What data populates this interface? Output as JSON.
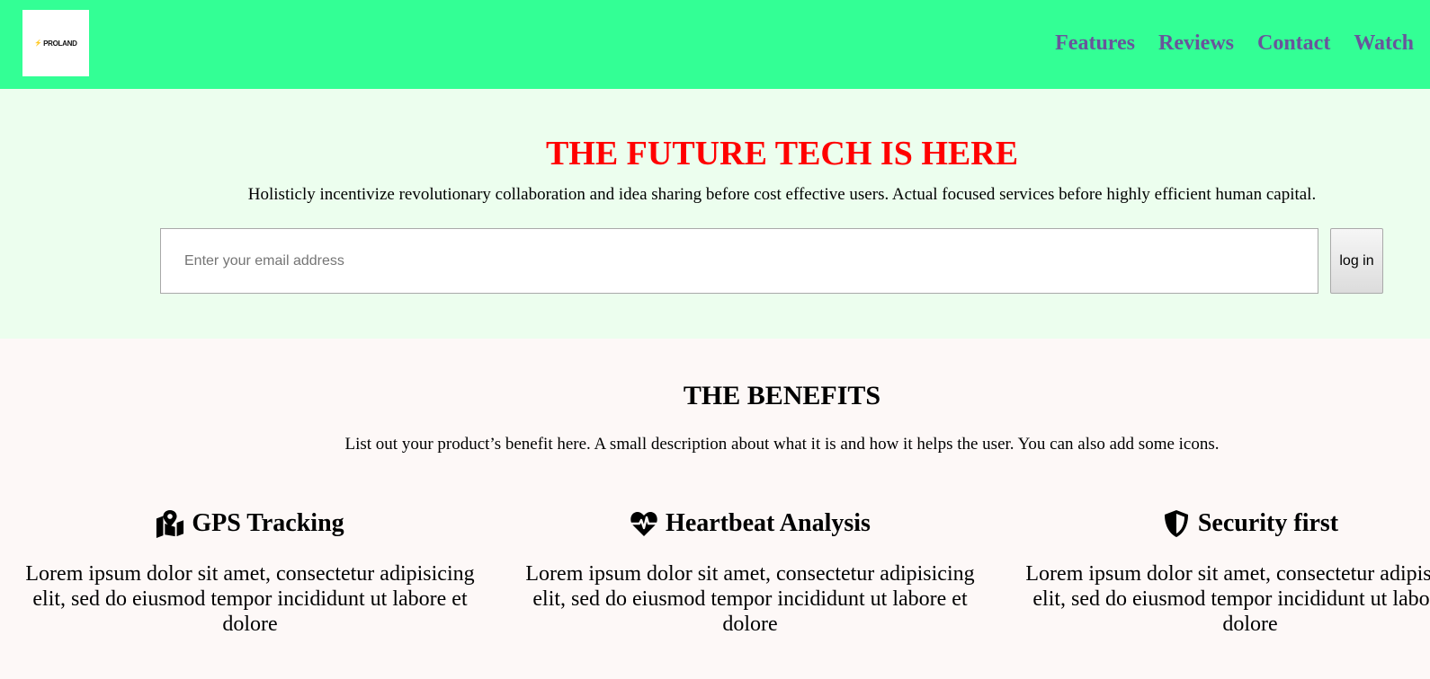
{
  "header": {
    "logo_text": "PROLAND",
    "nav": [
      "Features",
      "Reviews",
      "Contact",
      "Watch"
    ]
  },
  "hero": {
    "title": "THE FUTURE TECH IS HERE",
    "subtitle": "Holisticly incentivize revolutionary collaboration and idea sharing before cost effective users. Actual focused services before highly efficient human capital.",
    "email_placeholder": "Enter your email address",
    "login_label": "log in"
  },
  "benefits": {
    "title": "THE BENEFITS",
    "description": "List out your product’s benefit here. A small description about what it is and how it helps the user. You can also add some icons.",
    "cards": [
      {
        "icon": "map-marker-icon",
        "title": "GPS Tracking",
        "text": "Lorem ipsum dolor sit amet, consectetur adipisicing elit, sed do eiusmod tempor incididunt ut labore et dolore"
      },
      {
        "icon": "heartbeat-icon",
        "title": "Heartbeat Analysis",
        "text": "Lorem ipsum dolor sit amet, consectetur adipisicing elit, sed do eiusmod tempor incididunt ut labore et dolore"
      },
      {
        "icon": "shield-icon",
        "title": "Security first",
        "text": "Lorem ipsum dolor sit amet, consectetur adipisicing elit, sed do eiusmod tempor incididunt ut labore et dolore"
      }
    ]
  },
  "colors": {
    "header_bg": "#33ff95",
    "hero_bg": "#ecfeee",
    "page_bg": "#fdf8f7",
    "nav_link": "#69559b",
    "hero_title": "#ff0000"
  }
}
